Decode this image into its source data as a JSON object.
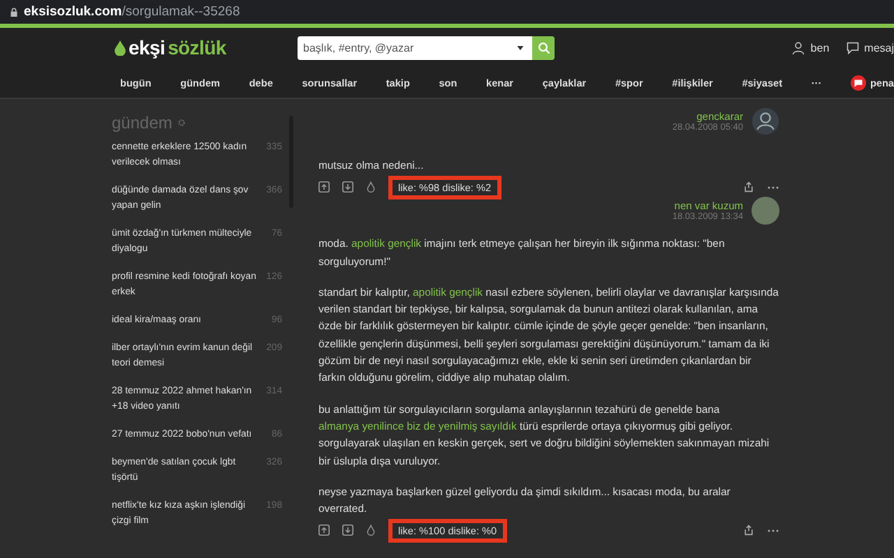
{
  "browser": {
    "url_host": "eksisozluk.com",
    "url_path": "/sorgulamak--35268"
  },
  "header": {
    "logo_first": "ekşi",
    "logo_second": "sözlük",
    "search_placeholder": "başlık, #entry, @yazar",
    "user_label": "ben",
    "messages_label": "mesaj"
  },
  "nav": [
    {
      "label": "bugün"
    },
    {
      "label": "gündem"
    },
    {
      "label": "debe"
    },
    {
      "label": "sorunsallar"
    },
    {
      "label": "takip"
    },
    {
      "label": "son"
    },
    {
      "label": "kenar"
    },
    {
      "label": "çaylaklar"
    },
    {
      "label": "#spor"
    },
    {
      "label": "#ilişkiler"
    },
    {
      "label": "#siyaset"
    },
    {
      "label": "···"
    }
  ],
  "nav_extra": "pena",
  "sidebar": {
    "title": "gündem",
    "items": [
      {
        "title": "cennette erkeklere 12500 kadın verilecek olması",
        "count": "335"
      },
      {
        "title": "düğünde damada özel dans şov yapan gelin",
        "count": "366"
      },
      {
        "title": "ümit özdağ'ın türkmen mülteciyle diyalogu",
        "count": "76"
      },
      {
        "title": "profil resmine kedi fotoğrafı koyan erkek",
        "count": "126"
      },
      {
        "title": "ideal kira/maaş oranı",
        "count": "96"
      },
      {
        "title": "ilber ortaylı'nın evrim kanun değil teori demesi",
        "count": "209"
      },
      {
        "title": "28 temmuz 2022 ahmet hakan'ın +18 video yanıtı",
        "count": "314"
      },
      {
        "title": "27 temmuz 2022 bobo'nun vefatı",
        "count": "86"
      },
      {
        "title": "beymen'de satılan çocuk lgbt tişörtü",
        "count": "326"
      },
      {
        "title": "netflix'te kız kıza aşkın işlendiği çizgi film",
        "count": "198"
      }
    ]
  },
  "previous_author": {
    "name": "genckarar",
    "date": "28.04.2008 05:40",
    "kind": "default"
  },
  "entries": [
    {
      "paragraphs": [
        [
          {
            "text": "mutsuz olma nedeni...",
            "kind": "text"
          }
        ]
      ],
      "stats": "like: %98 dislike: %2",
      "highlighted": true,
      "author": {
        "name": "nen var kuzum",
        "date": "18.03.2009 13:34",
        "kind": "photo"
      }
    },
    {
      "paragraphs": [
        [
          {
            "text": "moda. ",
            "kind": "text"
          },
          {
            "text": "apolitik gençlik",
            "kind": "link"
          },
          {
            "text": " imajını terk etmeye çalışan her bireyin ilk sığınma noktası: \"ben sorguluyorum!\"",
            "kind": "text"
          }
        ],
        [
          {
            "text": "standart bir kalıptır, ",
            "kind": "text"
          },
          {
            "text": "apolitik gençlik",
            "kind": "link"
          },
          {
            "text": " nasıl ezbere söylenen, belirli olaylar ve davranışlar karşısında verilen standart bir tepkiyse, bir kalıpsa, sorgulamak da bunun antitezi olarak kullanılan, ama özde bir farklılık göstermeyen bir kalıptır. cümle içinde de şöyle geçer genelde: \"ben insanların, özellikle gençlerin düşünmesi, belli şeyleri sorgulaması gerektiğini düşünüyorum.\" tamam da iki gözüm bir de neyi nasıl sorgulayacağımızı ekle, ekle ki senin seri üretimden çıkanlardan bir farkın olduğunu görelim, ciddiye alıp muhatap olalım.",
            "kind": "text"
          }
        ],
        [
          {
            "text": "bu anlattığım tür sorgulayıcıların sorgulama anlayışlarının tezahürü de genelde bana ",
            "kind": "text"
          },
          {
            "text": "almanya yenilince",
            "kind": "link"
          },
          {
            "text": "biz de yenilmiş sayıldık",
            "kind": "link"
          },
          {
            "text": " türü esprilerde ortaya çıkıyormuş gibi geliyor. sorgulayarak ulaşılan en keskin gerçek, sert ve doğru bildiğini söylemekten sakınmayan mizahi bir üslupla dışa vuruluyor.",
            "kind": "text"
          }
        ],
        [
          {
            "text": "neyse yazmaya başlarken güzel geliyordu da şimdi sıkıldım... kısacası moda, bu aralar overrated.",
            "kind": "text"
          }
        ]
      ],
      "stats": "like: %100 dislike: %0",
      "highlighted": true
    }
  ]
}
